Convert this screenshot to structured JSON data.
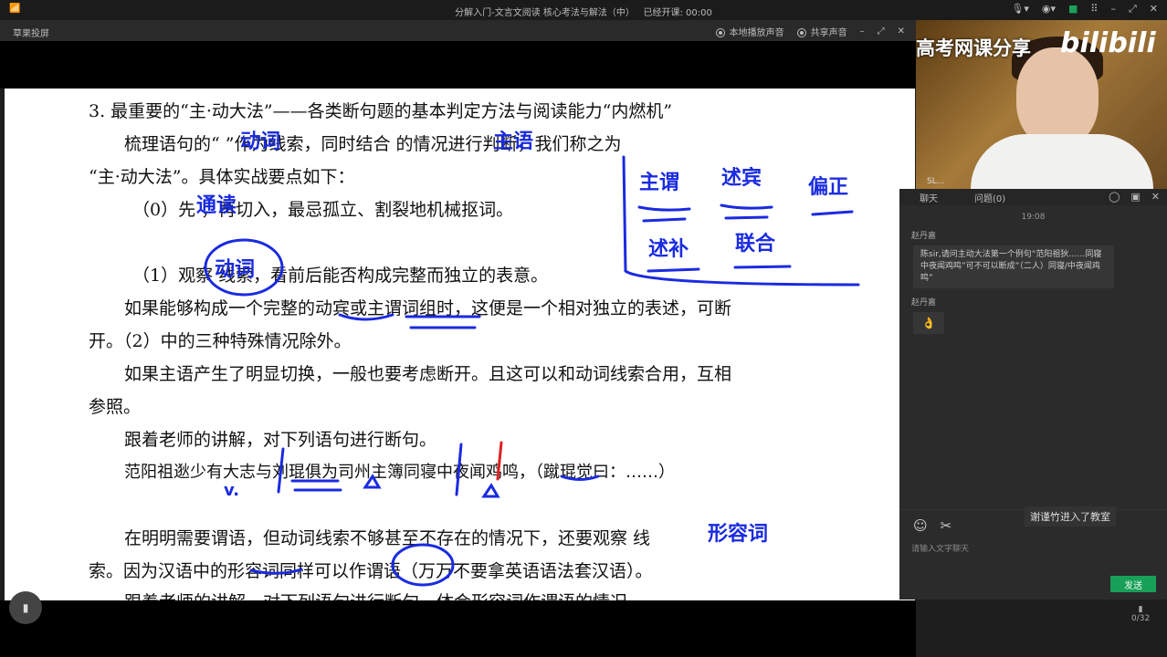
{
  "window": {
    "title": "分解入门-文言文阅读 核心考法与解法（中）",
    "elapsed": "已经开课: 00:00",
    "signal": "📶"
  },
  "subbar": {
    "app": "草果投屏",
    "local_sound": "本地播放声音",
    "share_sound": "共享声音"
  },
  "doc": {
    "lines": [
      "3. 最重要的“主·动大法”——各类断句题的基本判定方法与阅读能力“内燃机”",
      "梳理语句的“      ”作为线索，同时结合        的情况进行判断，我们称之为",
      "“主·动大法”。具体实战要点如下：",
      "（0）先        ，再切入，最忌孤立、割裂地机械抠词。",
      "（1）观察        线索，看前后能否构成完整而独立的表意。",
      "如果能够构成一个完整的动宾或主谓词组时，这便是一个相对独立的表述，可断",
      "开。（2）中的三种特殊情况除外。",
      "如果主语产生了明显切换，一般也要考虑断开。且这可以和动词线索合用，互相",
      "参照。",
      "跟着老师的讲解，对下列语句进行断句。",
      "范阳祖逖少有大志与刘琨俱为司州主簿同寝中夜闻鸡鸣，（蹴琨觉曰：……）",
      "在明明需要谓语，但动词线索不够甚至不存在的情况下，还要观察          线",
      "索。因为汉语中的形容词同样可以作谓语（万万不要拿英语语法套汉语）。",
      "跟着老师的讲解，对下列语句进行断句，体会形容词作谓语的情况"
    ],
    "handwriting": {
      "verb": "动词",
      "subject": "主语",
      "read": "通读",
      "verb2": "动词",
      "adj": "形容词",
      "v": "v.",
      "box": [
        "主谓",
        "述宾",
        "偏正",
        "述补",
        "联合"
      ]
    }
  },
  "cam": {
    "brand": "高考网课分享",
    "logo": "bilibili",
    "label": "SL..."
  },
  "chat": {
    "tab_chat": "聊天",
    "tab_questions": "问题(0)",
    "time": "19:08",
    "messages": [
      {
        "user": "赵丹嘉",
        "text": "陈sir,请问主动大法第一个例句“范阳祖狄……同寝中夜闻鸡鸣”可不可以断成”（二人）同寝/中夜闻鸡鸣”"
      },
      {
        "user": "赵丹嘉",
        "text": "👌"
      }
    ],
    "notice": "谢谨竹进入了教室",
    "placeholder": "请输入文字聊天",
    "send": "发送",
    "page": "0/32"
  }
}
